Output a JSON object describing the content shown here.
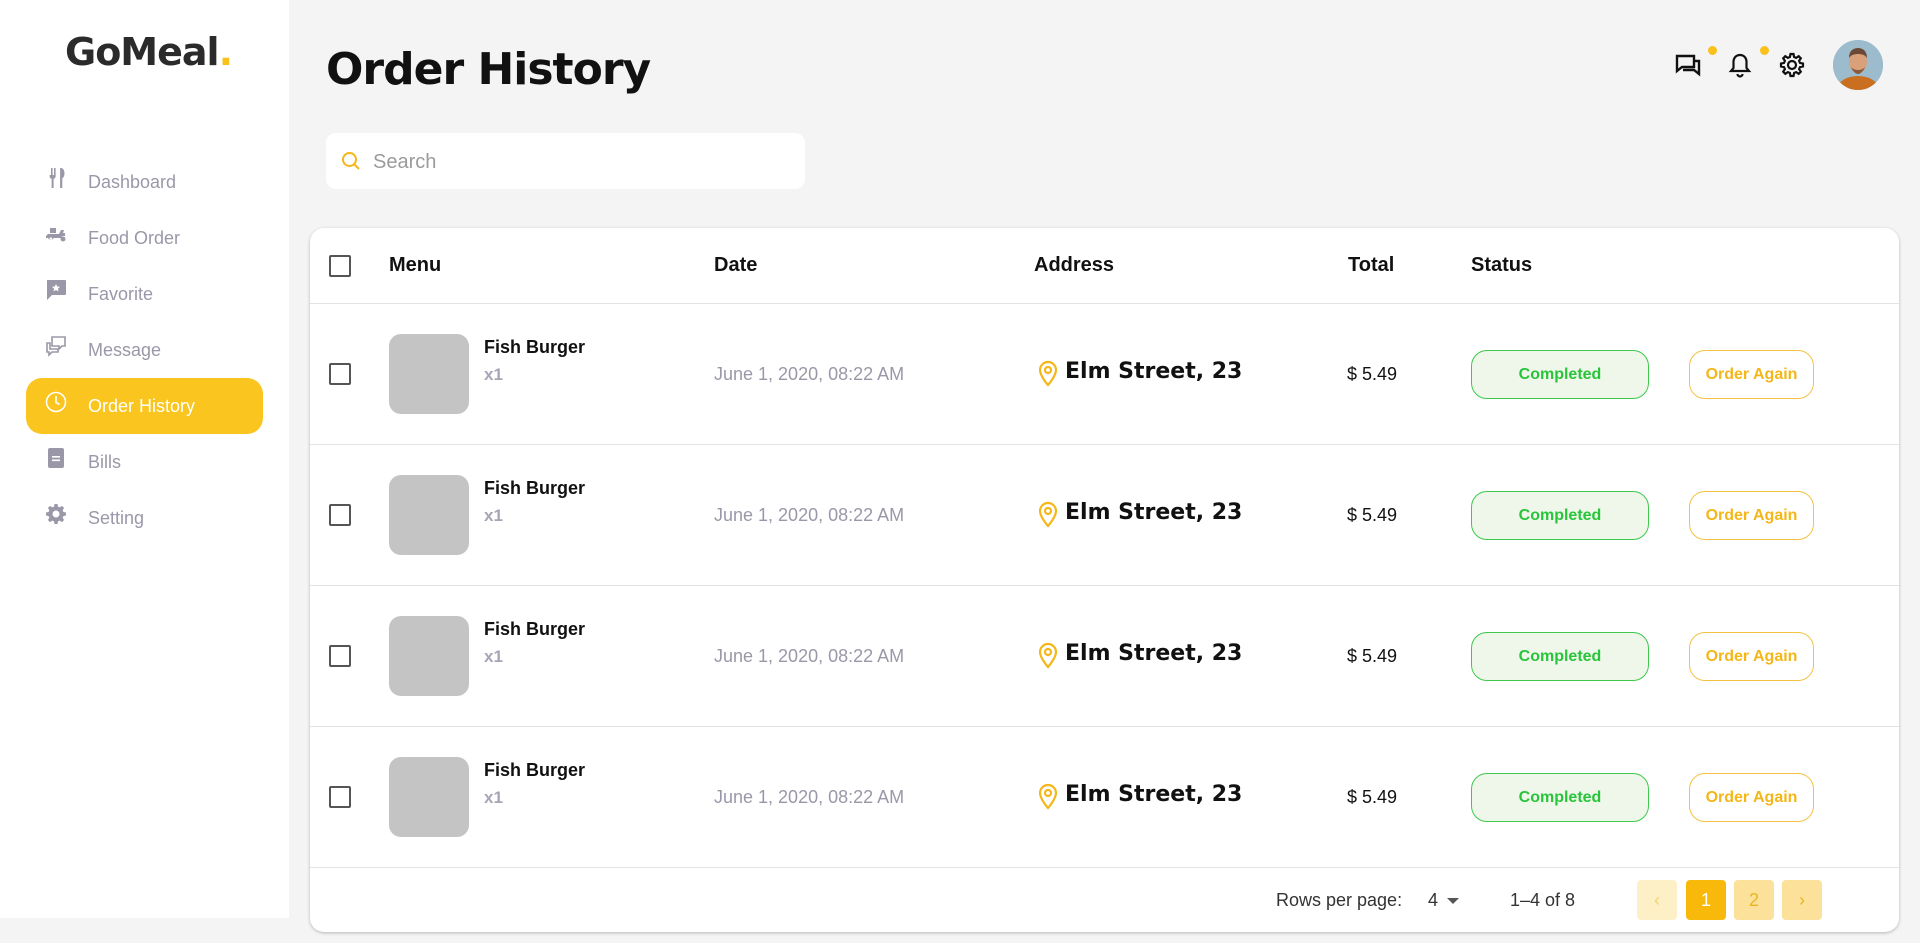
{
  "brand": {
    "name": "GoMeal",
    "dot": "."
  },
  "sidebar": {
    "items": [
      {
        "label": "Dashboard",
        "icon": "fork-knife-icon",
        "active": false
      },
      {
        "label": "Food Order",
        "icon": "delivery-scooter-icon",
        "active": false
      },
      {
        "label": "Favorite",
        "icon": "favorite-chat-icon",
        "active": false
      },
      {
        "label": "Message",
        "icon": "message-icon",
        "active": false
      },
      {
        "label": "Order History",
        "icon": "clock-icon",
        "active": true
      },
      {
        "label": "Bills",
        "icon": "bill-icon",
        "active": false
      },
      {
        "label": "Setting",
        "icon": "gear-icon",
        "active": false
      }
    ]
  },
  "header": {
    "title": "Order History"
  },
  "search": {
    "placeholder": "Search",
    "value": ""
  },
  "table": {
    "columns": [
      "Menu",
      "Date",
      "Address",
      "Total",
      "Status"
    ],
    "rows": [
      {
        "item": "Fish Burger",
        "qty": "x1",
        "date": "June 1, 2020, 08:22 AM",
        "address": "Elm Street, 23",
        "total": "$ 5.49",
        "status": "Completed",
        "action": "Order Again"
      },
      {
        "item": "Fish Burger",
        "qty": "x1",
        "date": "June 1, 2020, 08:22 AM",
        "address": "Elm Street, 23",
        "total": "$ 5.49",
        "status": "Completed",
        "action": "Order Again"
      },
      {
        "item": "Fish Burger",
        "qty": "x1",
        "date": "June 1, 2020, 08:22 AM",
        "address": "Elm Street, 23",
        "total": "$ 5.49",
        "status": "Completed",
        "action": "Order Again"
      },
      {
        "item": "Fish Burger",
        "qty": "x1",
        "date": "June 1, 2020, 08:22 AM",
        "address": "Elm Street, 23",
        "total": "$ 5.49",
        "status": "Completed",
        "action": "Order Again"
      }
    ]
  },
  "pagination": {
    "rows_per_page_label": "Rows per page:",
    "rows_per_page_value": "4",
    "range": "1–4 of 8",
    "pages": [
      "1",
      "2"
    ],
    "current_page": "1"
  },
  "colors": {
    "accent": "#fac51f",
    "status_green": "#29c43b",
    "background": "#f4f4f4"
  }
}
